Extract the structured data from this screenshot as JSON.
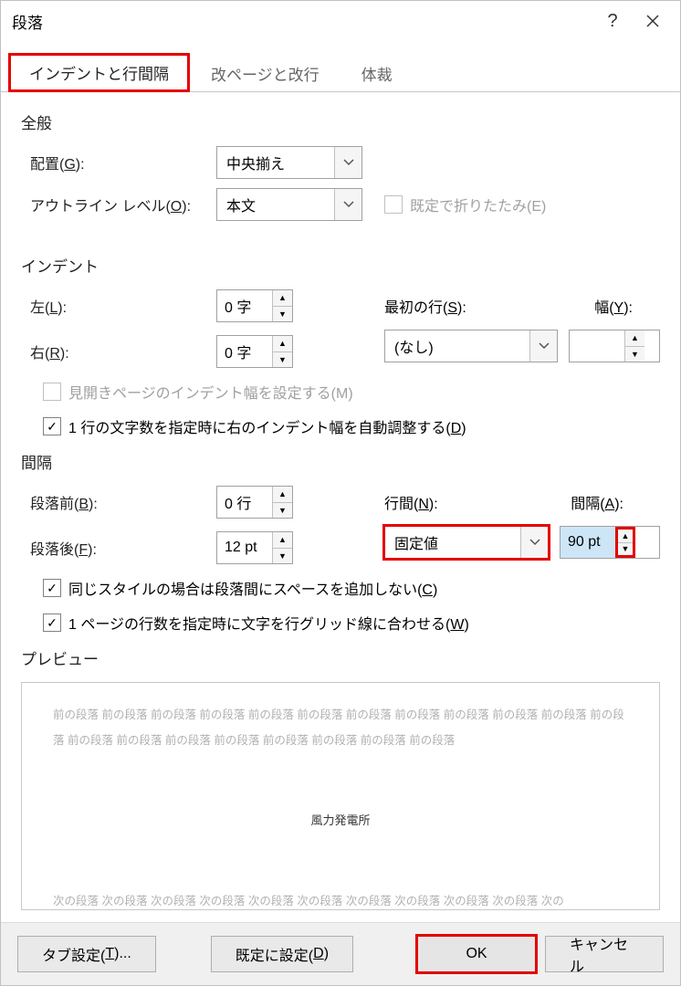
{
  "title": "段落",
  "tabs": {
    "indent": "インデントと行間隔",
    "breaks": "改ページと改行",
    "style": "体裁"
  },
  "general": {
    "heading": "全般",
    "align_label": "配置(G):",
    "align_value": "中央揃え",
    "outline_label": "アウトライン レベル(O):",
    "outline_value": "本文",
    "collapse_label": "既定で折りたたみ(E)"
  },
  "indent": {
    "heading": "インデント",
    "left_label": "左(L):",
    "left_value": "0 字",
    "right_label": "右(R):",
    "right_value": "0 字",
    "first_label": "最初の行(S):",
    "first_value": "(なし)",
    "width_label": "幅(Y):",
    "width_value": "",
    "mirror_label": "見開きページのインデント幅を設定する(M)",
    "auto_label": "1 行の文字数を指定時に右のインデント幅を自動調整する(D)"
  },
  "spacing": {
    "heading": "間隔",
    "before_label": "段落前(B):",
    "before_value": "0 行",
    "after_label": "段落後(F):",
    "after_value": "12 pt",
    "line_label": "行間(N):",
    "line_value": "固定値",
    "at_label": "間隔(A):",
    "at_value": "90 pt",
    "nospace_label": "同じスタイルの場合は段落間にスペースを追加しない(C)",
    "grid_label": "1 ページの行数を指定時に文字を行グリッド線に合わせる(W)"
  },
  "preview": {
    "heading": "プレビュー",
    "prev_para": "前の段落 前の段落 前の段落 前の段落 前の段落 前の段落 前の段落 前の段落 前の段落 前の段落 前の段落 前の段落 前の段落 前の段落 前の段落 前の段落 前の段落 前の段落 前の段落 前の段落",
    "sample": "風力発電所",
    "next_para": "次の段落 次の段落 次の段落 次の段落 次の段落 次の段落 次の段落 次の段落 次の段落 次の段落 次の"
  },
  "footer": {
    "tabs": "タブ設定(T)...",
    "default": "既定に設定(D)",
    "ok": "OK",
    "cancel": "キャンセル"
  }
}
